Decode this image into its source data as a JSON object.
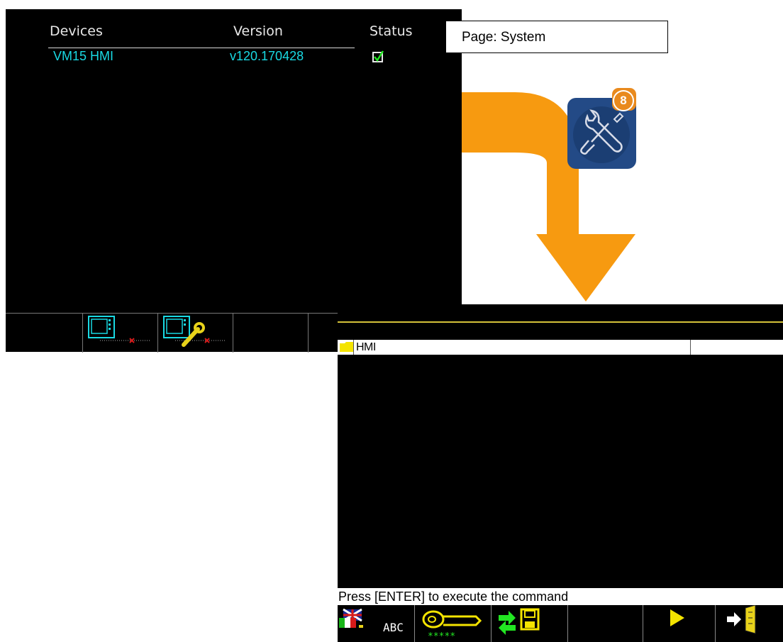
{
  "devices_screen": {
    "headers": {
      "devices": "Devices",
      "version": "Version",
      "status": "Status"
    },
    "rows": [
      {
        "device": "VM15 HMI",
        "version": "v120.170428",
        "status": "checked"
      }
    ]
  },
  "page_label": "Page: System",
  "app_icon": {
    "icon": "wrench-screwdriver-icon",
    "badge": "8",
    "color": "#234a86",
    "badge_color": "#e98a1e"
  },
  "arrow_color": "#f79a10",
  "commands_screen": {
    "folder_label": "HMI",
    "status_text": "Press [ENTER] to execute the command",
    "toolbar_abc_label": "ABC"
  }
}
